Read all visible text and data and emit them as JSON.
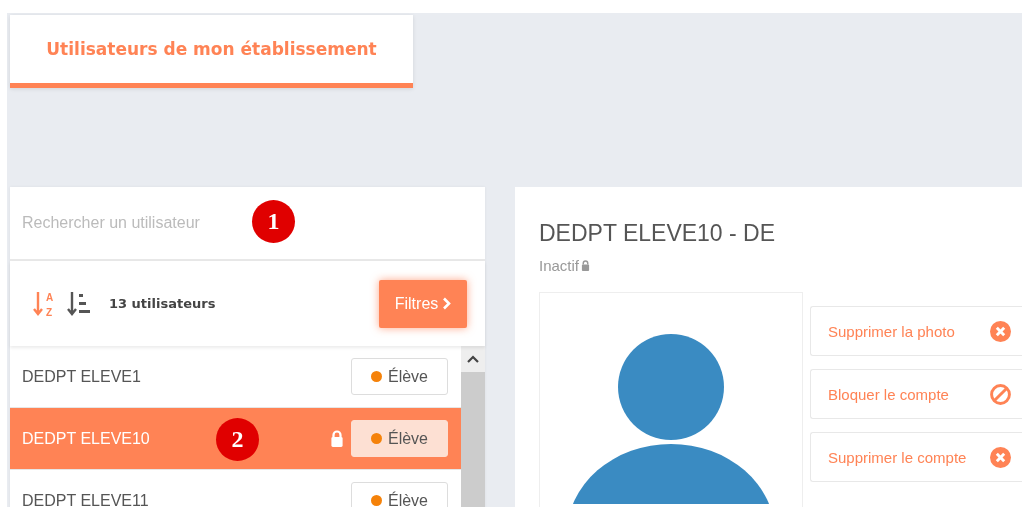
{
  "tab": {
    "label": "Utilisateurs de mon établissement",
    "selected": true
  },
  "search": {
    "placeholder": "Rechercher un utilisateur"
  },
  "toolbar": {
    "sort_letters": [
      "A",
      "Z"
    ],
    "count": "13 utilisateurs",
    "filter_button": "Filtres"
  },
  "users": [
    {
      "name": "DEDPT ELEVE1",
      "role": "Élève",
      "color": "#f5820a",
      "selected": false,
      "locked": false
    },
    {
      "name": "DEDPT ELEVE10",
      "role": "Élève",
      "color": "#f5820a",
      "selected": true,
      "locked": true
    },
    {
      "name": "DEDPT ELEVE11",
      "role": "Élève",
      "color": "#f5820a",
      "selected": false,
      "locked": false
    }
  ],
  "detail": {
    "name": "DEDPT ELEVE10 - DE",
    "status": "Inactif",
    "locked": true,
    "actions": [
      {
        "label": "Supprimer la photo",
        "kind": "remove"
      },
      {
        "label": "Bloquer le compte",
        "kind": "block"
      },
      {
        "label": "Supprimer le compte",
        "kind": "remove"
      }
    ]
  },
  "annotations": [
    {
      "label": "1"
    },
    {
      "label": "2"
    }
  ]
}
